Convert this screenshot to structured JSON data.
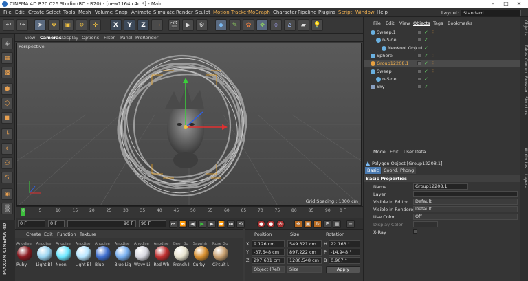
{
  "window": {
    "title": "CINEMA 4D R20.026 Studio (RC - R20) - [new1164.c4d *] - Main"
  },
  "menu": [
    "File",
    "Edit",
    "Create",
    "Select",
    "Tools",
    "Mesh",
    "Volume",
    "Snap",
    "Animate",
    "Simulate",
    "Render",
    "Sculpt",
    "Motion Tracker",
    "MoGraph",
    "Character",
    "Pipeline",
    "Plugins",
    "Script",
    "Window",
    "Help"
  ],
  "layout": {
    "label": "Layout:",
    "value": "Standard"
  },
  "viewport": {
    "menu": [
      "View",
      "Cameras",
      "Display",
      "Options",
      "Filter",
      "Panel",
      "ProRender"
    ],
    "label": "Perspective",
    "grid_spacing": "Grid Spacing : 1000 cm"
  },
  "timeline": {
    "ticks": [
      "0",
      "5",
      "10",
      "15",
      "20",
      "25",
      "30",
      "35",
      "40",
      "45",
      "50",
      "55",
      "60",
      "65",
      "70",
      "75",
      "80",
      "85",
      "90"
    ],
    "end": "0 F"
  },
  "transport": {
    "start": "0 F",
    "current": "0 F",
    "end_field": "90 F",
    "end2": "90 F"
  },
  "materials": {
    "tabs": [
      "Create",
      "Edit",
      "Function",
      "Texture"
    ],
    "items": [
      {
        "top": "Anodise",
        "name": "Ruby",
        "color": "#8a1a20"
      },
      {
        "top": "Anodise",
        "name": "Light Bl",
        "color": "#9ad4f0"
      },
      {
        "top": "Anodise",
        "name": "Neon",
        "color": "#6de8ff"
      },
      {
        "top": "Anodise",
        "name": "Light Bl",
        "color": "#b8e6ff"
      },
      {
        "top": "Anodise",
        "name": "Blue",
        "color": "#4070d0"
      },
      {
        "top": "Anodise",
        "name": "Blue Lig",
        "color": "#7ab0f0"
      },
      {
        "top": "Anodise",
        "name": "Wavy Li",
        "color": "#d8d8e0"
      },
      {
        "top": "Anodise",
        "name": "Red Wh",
        "color": "#c03030"
      },
      {
        "top": "Beer Bo",
        "name": "French I",
        "color": "#e8e4d0"
      },
      {
        "top": "Sapphir",
        "name": "Curby",
        "color": "#d89030"
      },
      {
        "top": "Rose Go",
        "name": "Circuit L",
        "color": "#c8a070"
      }
    ]
  },
  "coords": {
    "headers": [
      "Position",
      "Size",
      "Rotation"
    ],
    "rows": [
      {
        "axis": "X",
        "pos": "9.126 cm",
        "size": "549.321 cm",
        "rlabel": "H",
        "rot": "22.163 °"
      },
      {
        "axis": "Y",
        "pos": "-37.548 cm",
        "size": "897.222 cm",
        "rlabel": "P",
        "rot": "-14.948 °"
      },
      {
        "axis": "Z",
        "pos": "297.601 cm",
        "size": "1280.548 cm",
        "rlabel": "B",
        "rot": "0.907 °"
      }
    ],
    "mode1": "Object (Rel)",
    "mode2": "Size",
    "apply": "Apply"
  },
  "objects": {
    "menu": [
      "File",
      "Edit",
      "View",
      "Objects",
      "Tags",
      "Bookmarks"
    ],
    "rows": [
      {
        "name": "Sweep.1",
        "indent": 0,
        "color": "#6ab0e0"
      },
      {
        "name": "n-Side",
        "indent": 1,
        "color": "#6ab0e0"
      },
      {
        "name": "NeoKnot Object",
        "indent": 2,
        "color": "#6ab0e0"
      },
      {
        "name": "Sphere",
        "indent": 0,
        "color": "#6ab0e0"
      },
      {
        "name": "Group12208.1",
        "indent": 0,
        "color": "#e8a040"
      },
      {
        "name": "Sweep",
        "indent": 0,
        "color": "#6ab0e0"
      },
      {
        "name": "n-Side",
        "indent": 1,
        "color": "#6ab0e0"
      },
      {
        "name": "Sky",
        "indent": 0,
        "color": "#8aa0c0"
      }
    ]
  },
  "attributes": {
    "menu": [
      "Mode",
      "Edit",
      "User Data"
    ],
    "title": "Polygon Object [Group12208.1]",
    "tabs": [
      "Basic",
      "Coord.",
      "Phong"
    ],
    "section": "Basic Properties",
    "props": [
      {
        "label": "Name",
        "value": "Group12208.1"
      },
      {
        "label": "Layer",
        "value": ""
      },
      {
        "label": "Visible in Editor",
        "value": "Default"
      },
      {
        "label": "Visible in Renderer",
        "value": "Default"
      },
      {
        "label": "Use Color",
        "value": "Off"
      },
      {
        "label": "Display Color",
        "value": ""
      },
      {
        "label": "X-Ray",
        "value": ""
      }
    ]
  },
  "sidetabs": [
    "Objects",
    "Takes",
    "Content Browser",
    "Structure",
    "Attributes",
    "Layers"
  ]
}
